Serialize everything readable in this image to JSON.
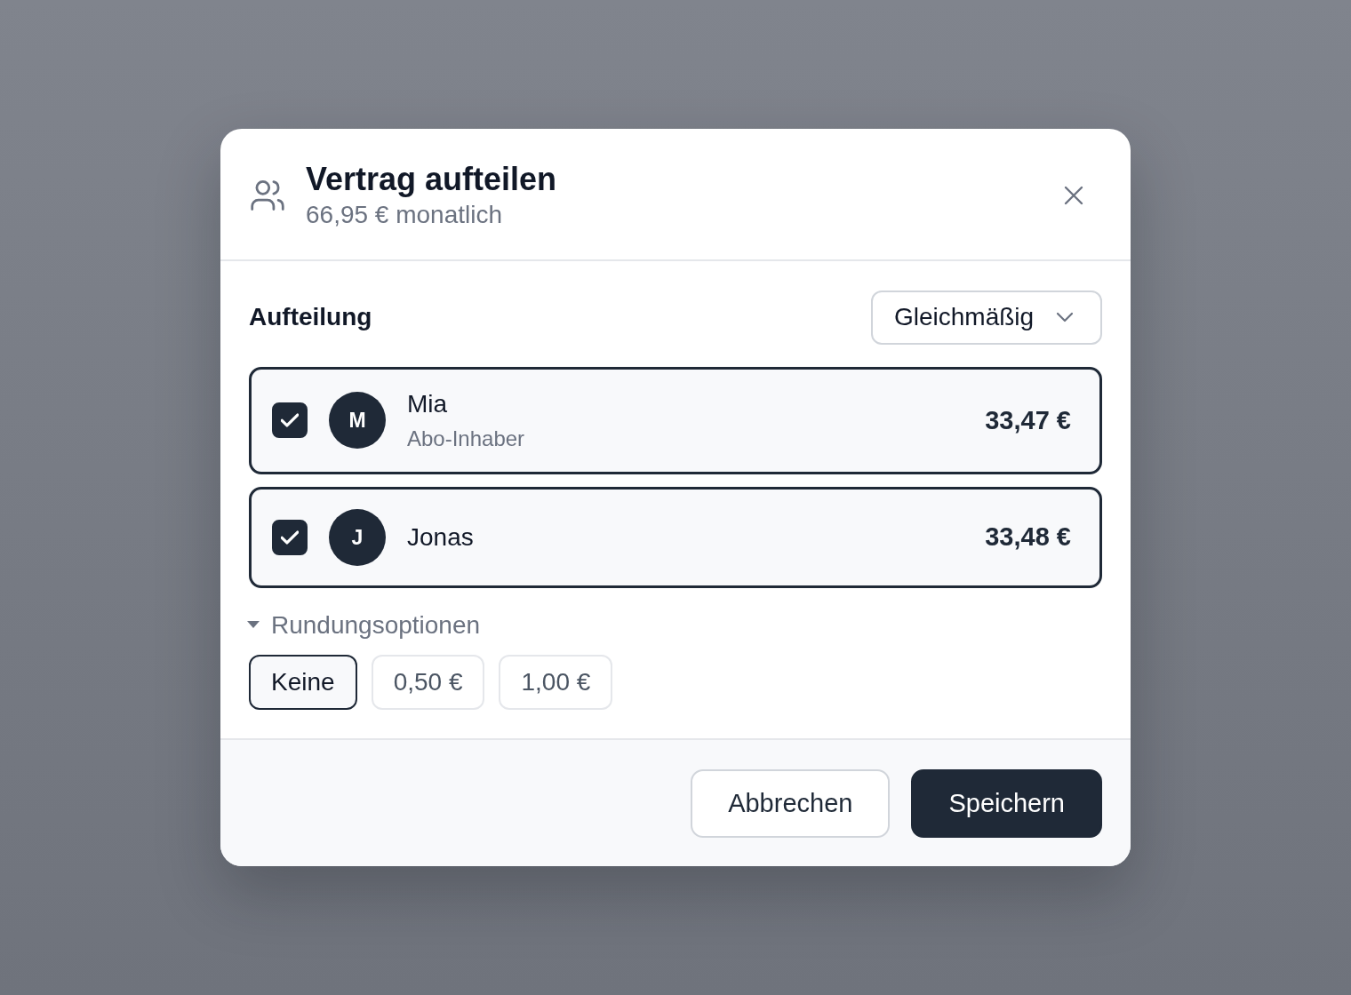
{
  "dialog": {
    "title": "Vertrag aufteilen",
    "subtitle": "66,95 € monatlich"
  },
  "split": {
    "label": "Aufteilung",
    "mode": "Gleichmäßig"
  },
  "participants": [
    {
      "initial": "M",
      "name": "Mia",
      "role": "Abo-Inhaber",
      "amount": "33,47 €",
      "checked": true
    },
    {
      "initial": "J",
      "name": "Jonas",
      "amount": "33,48 €",
      "checked": true
    }
  ],
  "rounding": {
    "label": "Rundungsoptionen",
    "expanded": true,
    "options": [
      {
        "label": "Keine",
        "selected": true
      },
      {
        "label": "0,50 €",
        "selected": false
      },
      {
        "label": "1,00 €",
        "selected": false
      }
    ]
  },
  "buttons": [
    {
      "label": "Abbrechen",
      "kind": "secondary"
    },
    {
      "label": "Speichern",
      "kind": "primary"
    }
  ]
}
